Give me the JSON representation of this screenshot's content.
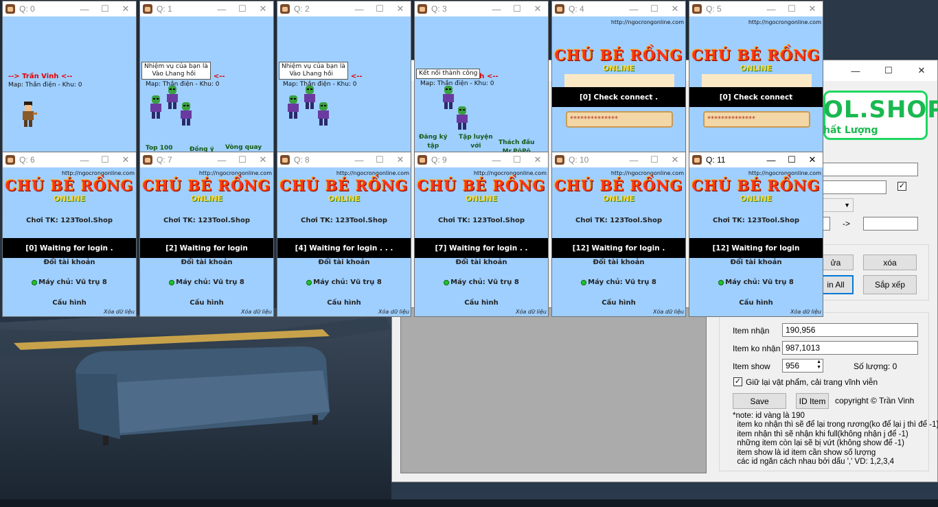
{
  "tool": {
    "logo_text": "OL.SHOP",
    "logo_sub": "hất Lượng",
    "min_icon": "minimize-icon",
    "max_icon": "maximize-icon",
    "close_icon": "close-icon",
    "arrow": "->",
    "btn_sua": "ửa",
    "btn_xoa": "xóa",
    "btn_login_all": "in All",
    "btn_sapxep": "Sắp xếp",
    "item_nhan_label": "Item nhận",
    "item_nhan_value": "190,956",
    "item_ko_nhan_label": "Item ko nhận",
    "item_ko_nhan_value": "987,1013",
    "item_show_label": "Item show",
    "item_show_value": "956",
    "so_luong": "Số lượng: 0",
    "giu_lai_label": "Giữ lại vật phẩm, cải trang vĩnh viễn",
    "save_label": "Save",
    "id_item_label": "ID Item",
    "copyright": "copyright © Trần Vinh",
    "notes": [
      "*note: id vàng là 190",
      "  item ko nhận thì sẽ để lại trong rương(ko để lại j thì để -1)",
      "  item nhận thì sẽ nhận khi full(không nhận j để -1)",
      "  những item còn lại sẽ bị vứt (không show để -1)",
      "  item show là id item cần show số lượng",
      "  các id ngăn cách nhau bởi dấu ',' VD: 1,2,3,4"
    ]
  },
  "game": {
    "url": "http://ngocrongonline.com",
    "logo": "CHÚ BÉ RỒNG",
    "logo_sub": "ONLINE",
    "account": "Chơi TK: 123Tool.Shop",
    "doi_tai_khoan": "Đổi tài khoản",
    "may_chu": "Máy chủ: Vũ trụ 8",
    "cau_hinh": "Cấu hình",
    "xoa_du_lieu": "Xóa dữ liệu",
    "password_mask": "**************",
    "player_name": "--> Trần Vinh <--",
    "map_text": "Map: Thần điện - Khu: 0",
    "quest_bubble": "Nhiệm vụ của bạn là\n    Vào Lhang hồi",
    "connected_bubble": "Kết nối thành công",
    "menu_top100": "Top 100",
    "menu_dong_y": "Đồng ý",
    "menu_vong_quay": "Vòng quay",
    "menu_dang_ky": "Đăng ký\ntập",
    "menu_tap_luyen": "Tập luyện\nvới",
    "menu_thach_dau": "Thách đấu\nMr.PôPô"
  },
  "windows": [
    {
      "title": "Q: 0",
      "scene": "map"
    },
    {
      "title": "Q: 1",
      "scene": "quest"
    },
    {
      "title": "Q: 2",
      "scene": "quest2"
    },
    {
      "title": "Q: 3",
      "scene": "connected"
    },
    {
      "title": "Q: 4",
      "scene": "connect",
      "bar": "[0] Check connect ."
    },
    {
      "title": "Q: 5",
      "scene": "connect",
      "bar": "[0] Check connect"
    },
    {
      "title": "Q: 6",
      "scene": "login",
      "bar": "[0] Waiting for login ."
    },
    {
      "title": "Q: 7",
      "scene": "login",
      "bar": "[2] Waiting for login"
    },
    {
      "title": "Q: 8",
      "scene": "login",
      "bar": "[4] Waiting for login . . ."
    },
    {
      "title": "Q: 9",
      "scene": "login",
      "bar": "[7] Waiting for login . ."
    },
    {
      "title": "Q: 10",
      "scene": "login",
      "bar": "[12] Waiting for login ."
    },
    {
      "title": "Q: 11",
      "scene": "login",
      "bar": "[12] Waiting for login",
      "active": true
    }
  ]
}
